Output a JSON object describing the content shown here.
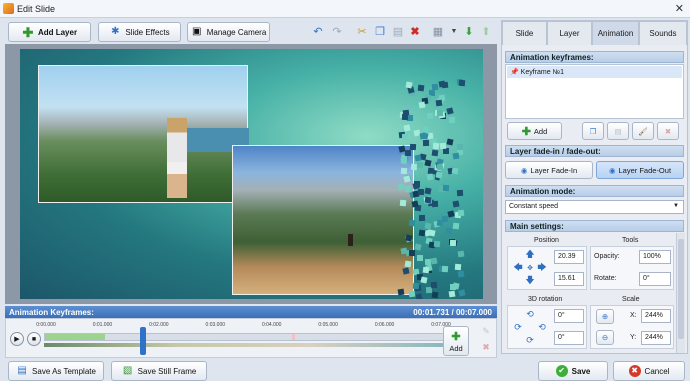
{
  "window": {
    "title": "Edit Slide",
    "close_glyph": "✕"
  },
  "toolbar": {
    "add_layer": "Add Layer",
    "slide_effects": "Slide Effects",
    "manage_camera": "Manage Camera"
  },
  "tabs": [
    "Slide",
    "Layer",
    "Animation",
    "Sounds"
  ],
  "active_tab": "Animation",
  "keyframes": {
    "header": "Animation keyframes:",
    "items": [
      "Keyframe №1"
    ],
    "add_label": "Add"
  },
  "fade": {
    "header": "Layer fade-in / fade-out:",
    "fade_in": "Layer Fade-In",
    "fade_out": "Layer Fade-Out"
  },
  "mode": {
    "header": "Animation mode:",
    "value": "Constant speed"
  },
  "main_settings": {
    "header": "Main settings:",
    "position_label": "Position",
    "tools_label": "Tools",
    "pos_x": "20.39",
    "pos_y": "15.61",
    "opacity_label": "Opacity:",
    "opacity": "100%",
    "rotate_label": "Rotate:",
    "rotate": "0°",
    "rotation3d_label": "3D rotation",
    "rot3d_1": "0°",
    "rot3d_2": "0°",
    "scale_label": "Scale",
    "scale_x_label": "X:",
    "scale_x": "244%",
    "scale_y_label": "Y:",
    "scale_y": "244%"
  },
  "timeline": {
    "header": "Animation Keyframes:",
    "time": "00:01.731 / 00:07.000",
    "ticks": [
      "0:00.000",
      "0:01.000",
      "0:02.000",
      "0:03.000",
      "0:04.000",
      "0:05.000",
      "0:06.000",
      "0:07.000"
    ],
    "add_label": "Add",
    "playhead_fraction": 0.247
  },
  "bottom": {
    "save_template": "Save As Template",
    "save_frame": "Save Still Frame",
    "save": "Save",
    "cancel": "Cancel"
  },
  "colors": {
    "accent": "#3a6fb8",
    "header_blue": "#5d8fd0",
    "save_green": "#3fae3a",
    "cancel_red": "#d23b2b"
  }
}
